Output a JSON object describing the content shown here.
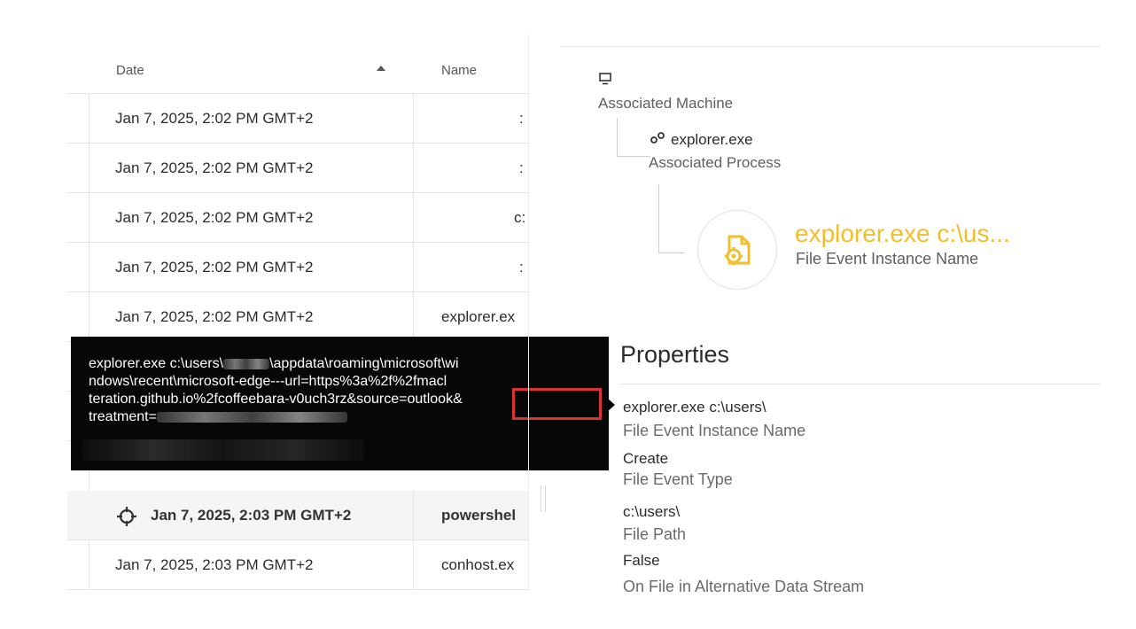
{
  "table": {
    "columns": {
      "date": "Date",
      "name": "Name"
    },
    "rows": [
      {
        "date": "Jan 7, 2025, 2:02 PM GMT+2",
        "name": ":"
      },
      {
        "date": "Jan 7, 2025, 2:02 PM GMT+2",
        "name": ":"
      },
      {
        "date": "Jan 7, 2025, 2:02 PM GMT+2",
        "name": "c:"
      },
      {
        "date": "Jan 7, 2025, 2:02 PM GMT+2",
        "name": ":"
      },
      {
        "date": "Jan 7, 2025, 2:02 PM GMT+2",
        "name": "explorer.ex"
      },
      {
        "date": "Jan 7, 2025, 2:03 PM GMT+2",
        "name": "powershel"
      },
      {
        "date": "Jan 7, 2025, 2:03 PM GMT+2",
        "name": "conhost.ex"
      }
    ]
  },
  "tooltip": {
    "line1_pre": "explorer.exe c:\\users\\",
    "line1_post": "\\appdata\\roaming\\microsoft\\wi",
    "line2": "ndows\\recent\\microsoft-edge---url=https%3a%2f%2fmacl",
    "line3": "teration.github.io%2fcoffeebara-v0uch3rz&source=outlook&",
    "line4": "treatment="
  },
  "details": {
    "machine": {
      "label": "Associated Machine",
      "icon": "monitor-icon"
    },
    "process": {
      "name": "explorer.exe",
      "label": "Associated Process",
      "icon": "process-icon"
    },
    "event": {
      "name": "explorer.exe c:\\us...",
      "label": "File Event Instance Name",
      "icon": "file-gear-icon"
    },
    "properties_title": "Properties",
    "properties": [
      {
        "value": "explorer.exe c:\\users\\",
        "label": "File Event Instance Name"
      },
      {
        "value": "Create",
        "label": "File Event Type"
      },
      {
        "value": "c:\\users\\",
        "label": "File Path"
      },
      {
        "value": "False",
        "label": "On File in Alternative Data Stream"
      }
    ]
  },
  "colors": {
    "accent": "#f2bf2c",
    "highlight_box": "#d93434",
    "tooltip_bg": "#070707"
  }
}
